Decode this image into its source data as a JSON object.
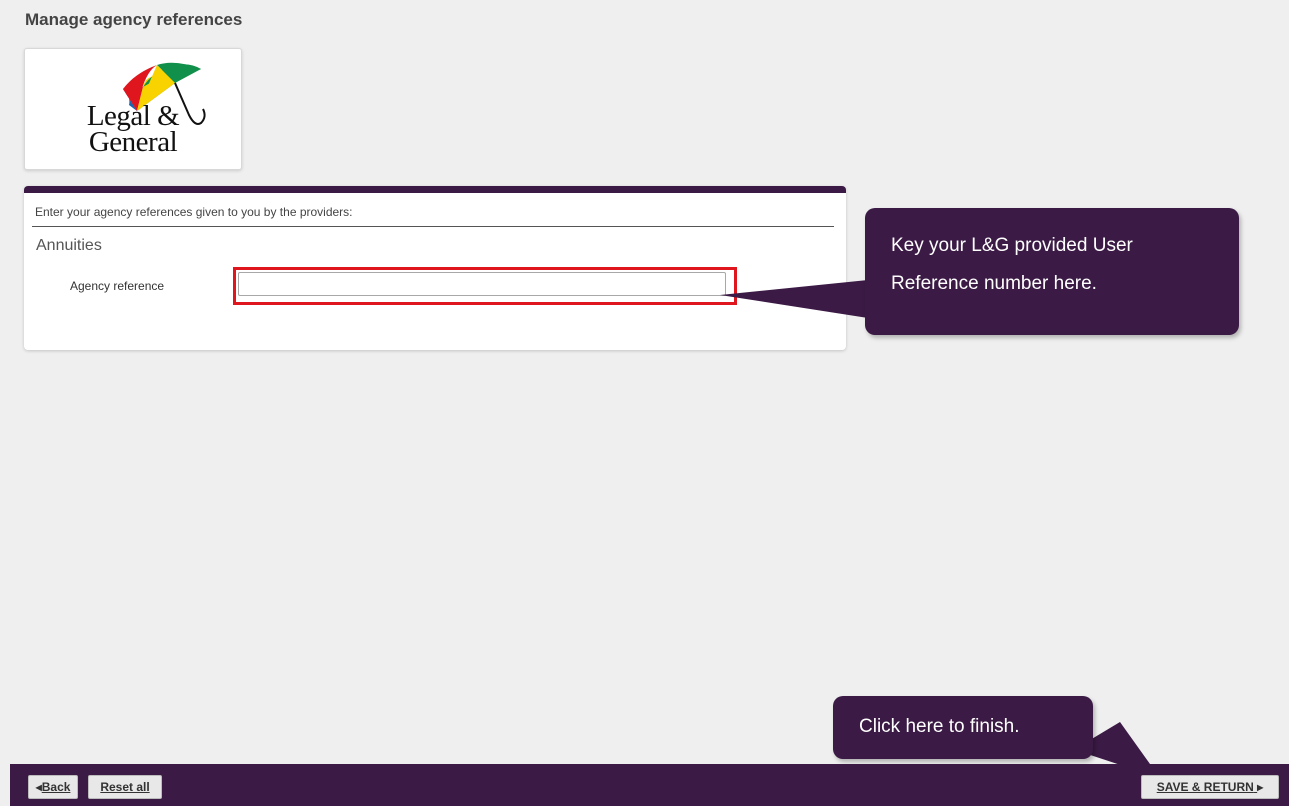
{
  "page": {
    "title": "Manage agency references"
  },
  "logo": {
    "line1": "Legal &",
    "line2": "General",
    "colors": {
      "red": "#e0161e",
      "yellow": "#f9d300",
      "green": "#10904a",
      "blue": "#1668b4",
      "handle": "#111111"
    }
  },
  "panel": {
    "instruction": "Enter your agency references given to you by the providers:",
    "section_heading": "Annuities",
    "field": {
      "label": "Agency reference",
      "value": "",
      "placeholder": ""
    }
  },
  "callouts": {
    "field_hint": "Key your L&G provided User Reference number here.",
    "finish_hint": "Click here to finish."
  },
  "footer": {
    "back_label": "Back",
    "reset_label": "Reset all",
    "save_label": "SAVE & RETURN"
  },
  "colors": {
    "brand_purple": "#3b1a45",
    "highlight_red": "#e0161e",
    "background": "#efefef"
  }
}
